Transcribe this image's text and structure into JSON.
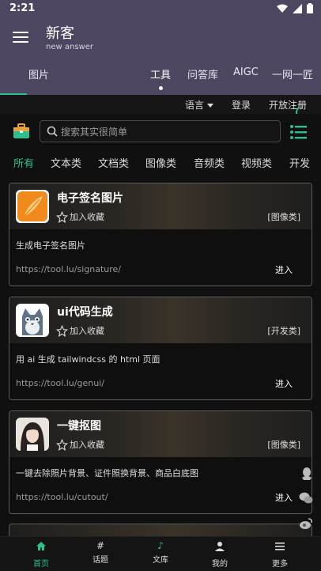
{
  "status_bar": {
    "time": "2:21"
  },
  "header": {
    "title": "新客",
    "subtitle": "new answer"
  },
  "top_tabs": [
    {
      "label": "图片",
      "state": "normal"
    },
    {
      "label": "工具",
      "state": "active"
    },
    {
      "label": "问答库",
      "state": "normal"
    },
    {
      "label": "AIGC",
      "state": "normal"
    },
    {
      "label": "一网一匠",
      "state": "normal"
    }
  ],
  "lang_bar": {
    "language": "语言",
    "login": "登录",
    "register": "开放注册"
  },
  "search": {
    "placeholder": "搜索其实很简单"
  },
  "categories": [
    "所有",
    "文本类",
    "文档类",
    "图像类",
    "音频类",
    "视频类",
    "开发"
  ],
  "cards": [
    {
      "title": "电子签名图片",
      "fav_label": "加入收藏",
      "tag": "[图像类]",
      "desc": "生成电子签名图片",
      "url": "https://tool.lu/signature/",
      "enter": "进入",
      "thumb": "orange-feather"
    },
    {
      "title": "ui代码生成",
      "fav_label": "加入收藏",
      "tag": "[开发类]",
      "desc": "用 ai 生成 tailwindcss 的 html 页面",
      "url": "https://tool.lu/genui/",
      "enter": "进入",
      "thumb": "cartoon-cat"
    },
    {
      "title": "一键抠图",
      "fav_label": "加入收藏",
      "tag": "[图像类]",
      "desc": "一键去除照片背景、证件照换背景、商品白底图",
      "url": "https://tool.lu/cutout/",
      "enter": "进入",
      "thumb": "portrait-photo"
    }
  ],
  "bottom_nav": [
    {
      "label": "首页",
      "icon": "home-icon",
      "active": true
    },
    {
      "label": "话题",
      "icon": "hash-icon",
      "active": false
    },
    {
      "label": "文库",
      "icon": "music-note-icon",
      "active": false
    },
    {
      "label": "我的",
      "icon": "user-icon",
      "active": false
    },
    {
      "label": "更多",
      "icon": "more-icon",
      "active": false
    }
  ],
  "colors": {
    "header_bg": "#4d4660",
    "accent": "#2fbf8f",
    "page_bg": "#101010"
  }
}
